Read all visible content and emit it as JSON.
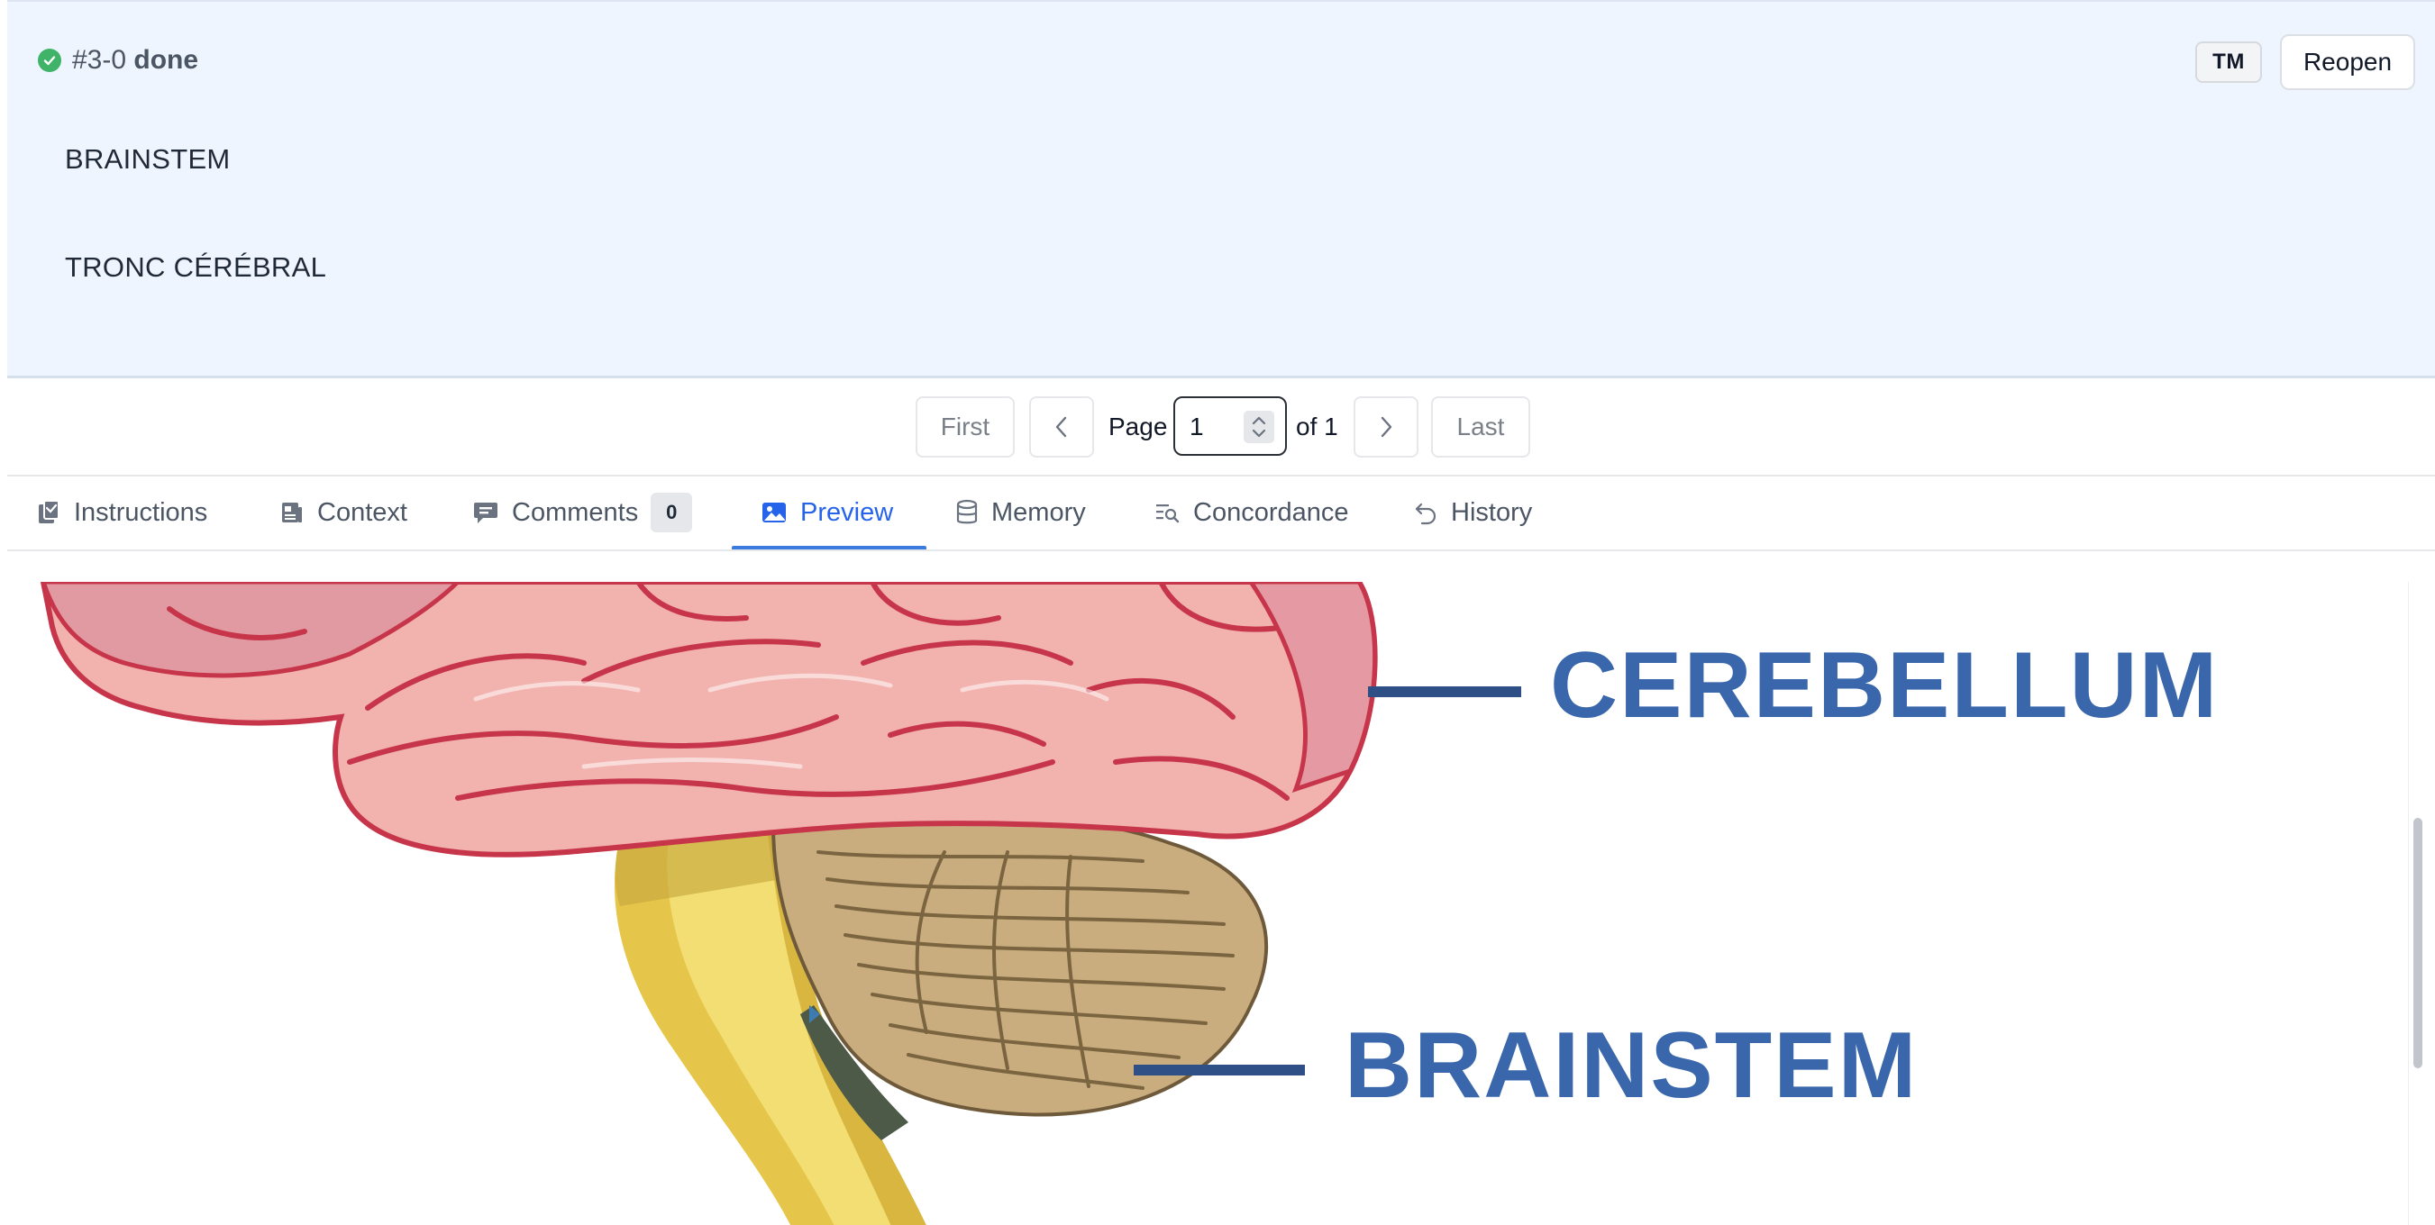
{
  "unit": {
    "id": "#3-0",
    "status": "done",
    "source_text": "BRAINSTEM",
    "target_text": "TRONC CÉRÉBRAL",
    "tm_label": "TM",
    "reopen_label": "Reopen"
  },
  "pagination": {
    "first_label": "First",
    "last_label": "Last",
    "page_label": "Page",
    "current_page": "1",
    "of_label": "of 1"
  },
  "tabs": [
    {
      "label": "Instructions",
      "icon": "clipboard-icon"
    },
    {
      "label": "Context",
      "icon": "document-icon"
    },
    {
      "label": "Comments",
      "icon": "chat-bubble-icon",
      "count": "0"
    },
    {
      "label": "Preview",
      "icon": "image-icon",
      "active": true
    },
    {
      "label": "Memory",
      "icon": "database-icon"
    },
    {
      "label": "Concordance",
      "icon": "text-search-icon"
    },
    {
      "label": "History",
      "icon": "undo-arrow-icon"
    }
  ],
  "preview": {
    "label_cerebellum": "CEREBELLUM",
    "label_brainstem": "BRAINSTEM"
  },
  "colors": {
    "panel_bg": "#eef5fe",
    "accent": "#2563eb",
    "status_green": "#3fb368",
    "diagram_label": "#3a67ab"
  }
}
